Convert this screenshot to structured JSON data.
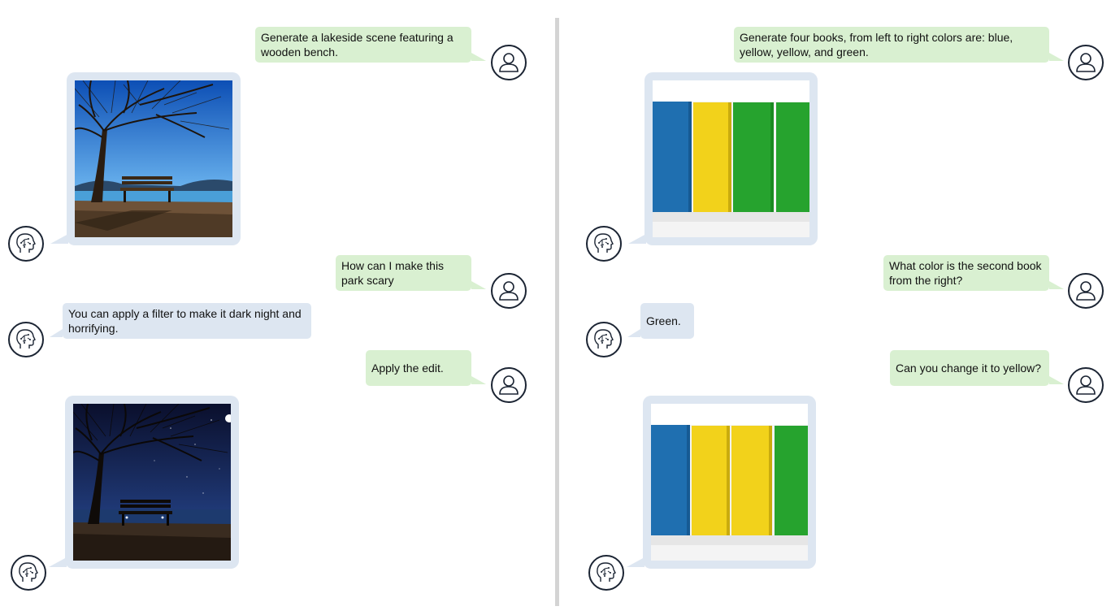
{
  "left": {
    "messages": [
      {
        "role": "user",
        "text": "Generate a lakeside scene featuring a wooden bench."
      },
      {
        "role": "assistant",
        "image": "lakeside-bench-day"
      },
      {
        "role": "user",
        "text": "How  can I make this park scary"
      },
      {
        "role": "assistant",
        "text": "You can apply a filter to make it dark night and horrifying."
      },
      {
        "role": "user",
        "text": "Apply the edit."
      },
      {
        "role": "assistant",
        "image": "lakeside-bench-night"
      }
    ]
  },
  "right": {
    "messages": [
      {
        "role": "user",
        "text": "Generate four books, from left to right colors are: blue, yellow, yellow, and green."
      },
      {
        "role": "assistant",
        "image": "four-books-blue-yellow-yellow-green"
      },
      {
        "role": "user",
        "text": "What color is the second book from the right?"
      },
      {
        "role": "assistant",
        "text": "Green."
      },
      {
        "role": "user",
        "text": "Can you change it to yellow?"
      },
      {
        "role": "assistant",
        "image": "four-books-edited"
      }
    ]
  },
  "icons": {
    "user": "user-avatar-icon",
    "assistant": "brain-head-icon"
  },
  "colors": {
    "user_bubble": "#d9f0d1",
    "assistant_bubble": "#dde6f1",
    "book_blue": "#1f6fb0",
    "book_yellow": "#f2d21b",
    "book_green": "#26a32e",
    "divider": "#d4d4d4"
  }
}
